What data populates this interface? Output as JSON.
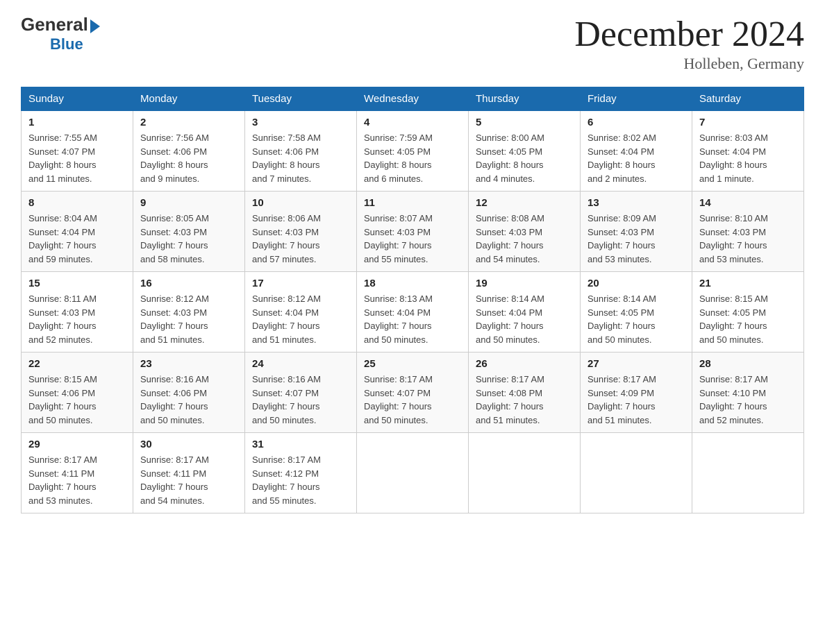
{
  "header": {
    "logo_general": "General",
    "logo_blue": "Blue",
    "calendar_title": "December 2024",
    "location": "Holleben, Germany"
  },
  "days_of_week": [
    "Sunday",
    "Monday",
    "Tuesday",
    "Wednesday",
    "Thursday",
    "Friday",
    "Saturday"
  ],
  "weeks": [
    [
      {
        "num": "1",
        "sunrise": "7:55 AM",
        "sunset": "4:07 PM",
        "daylight": "8 hours and 11 minutes."
      },
      {
        "num": "2",
        "sunrise": "7:56 AM",
        "sunset": "4:06 PM",
        "daylight": "8 hours and 9 minutes."
      },
      {
        "num": "3",
        "sunrise": "7:58 AM",
        "sunset": "4:06 PM",
        "daylight": "8 hours and 7 minutes."
      },
      {
        "num": "4",
        "sunrise": "7:59 AM",
        "sunset": "4:05 PM",
        "daylight": "8 hours and 6 minutes."
      },
      {
        "num": "5",
        "sunrise": "8:00 AM",
        "sunset": "4:05 PM",
        "daylight": "8 hours and 4 minutes."
      },
      {
        "num": "6",
        "sunrise": "8:02 AM",
        "sunset": "4:04 PM",
        "daylight": "8 hours and 2 minutes."
      },
      {
        "num": "7",
        "sunrise": "8:03 AM",
        "sunset": "4:04 PM",
        "daylight": "8 hours and 1 minute."
      }
    ],
    [
      {
        "num": "8",
        "sunrise": "8:04 AM",
        "sunset": "4:04 PM",
        "daylight": "7 hours and 59 minutes."
      },
      {
        "num": "9",
        "sunrise": "8:05 AM",
        "sunset": "4:03 PM",
        "daylight": "7 hours and 58 minutes."
      },
      {
        "num": "10",
        "sunrise": "8:06 AM",
        "sunset": "4:03 PM",
        "daylight": "7 hours and 57 minutes."
      },
      {
        "num": "11",
        "sunrise": "8:07 AM",
        "sunset": "4:03 PM",
        "daylight": "7 hours and 55 minutes."
      },
      {
        "num": "12",
        "sunrise": "8:08 AM",
        "sunset": "4:03 PM",
        "daylight": "7 hours and 54 minutes."
      },
      {
        "num": "13",
        "sunrise": "8:09 AM",
        "sunset": "4:03 PM",
        "daylight": "7 hours and 53 minutes."
      },
      {
        "num": "14",
        "sunrise": "8:10 AM",
        "sunset": "4:03 PM",
        "daylight": "7 hours and 53 minutes."
      }
    ],
    [
      {
        "num": "15",
        "sunrise": "8:11 AM",
        "sunset": "4:03 PM",
        "daylight": "7 hours and 52 minutes."
      },
      {
        "num": "16",
        "sunrise": "8:12 AM",
        "sunset": "4:03 PM",
        "daylight": "7 hours and 51 minutes."
      },
      {
        "num": "17",
        "sunrise": "8:12 AM",
        "sunset": "4:04 PM",
        "daylight": "7 hours and 51 minutes."
      },
      {
        "num": "18",
        "sunrise": "8:13 AM",
        "sunset": "4:04 PM",
        "daylight": "7 hours and 50 minutes."
      },
      {
        "num": "19",
        "sunrise": "8:14 AM",
        "sunset": "4:04 PM",
        "daylight": "7 hours and 50 minutes."
      },
      {
        "num": "20",
        "sunrise": "8:14 AM",
        "sunset": "4:05 PM",
        "daylight": "7 hours and 50 minutes."
      },
      {
        "num": "21",
        "sunrise": "8:15 AM",
        "sunset": "4:05 PM",
        "daylight": "7 hours and 50 minutes."
      }
    ],
    [
      {
        "num": "22",
        "sunrise": "8:15 AM",
        "sunset": "4:06 PM",
        "daylight": "7 hours and 50 minutes."
      },
      {
        "num": "23",
        "sunrise": "8:16 AM",
        "sunset": "4:06 PM",
        "daylight": "7 hours and 50 minutes."
      },
      {
        "num": "24",
        "sunrise": "8:16 AM",
        "sunset": "4:07 PM",
        "daylight": "7 hours and 50 minutes."
      },
      {
        "num": "25",
        "sunrise": "8:17 AM",
        "sunset": "4:07 PM",
        "daylight": "7 hours and 50 minutes."
      },
      {
        "num": "26",
        "sunrise": "8:17 AM",
        "sunset": "4:08 PM",
        "daylight": "7 hours and 51 minutes."
      },
      {
        "num": "27",
        "sunrise": "8:17 AM",
        "sunset": "4:09 PM",
        "daylight": "7 hours and 51 minutes."
      },
      {
        "num": "28",
        "sunrise": "8:17 AM",
        "sunset": "4:10 PM",
        "daylight": "7 hours and 52 minutes."
      }
    ],
    [
      {
        "num": "29",
        "sunrise": "8:17 AM",
        "sunset": "4:11 PM",
        "daylight": "7 hours and 53 minutes."
      },
      {
        "num": "30",
        "sunrise": "8:17 AM",
        "sunset": "4:11 PM",
        "daylight": "7 hours and 54 minutes."
      },
      {
        "num": "31",
        "sunrise": "8:17 AM",
        "sunset": "4:12 PM",
        "daylight": "7 hours and 55 minutes."
      },
      null,
      null,
      null,
      null
    ]
  ],
  "labels": {
    "sunrise": "Sunrise:",
    "sunset": "Sunset:",
    "daylight": "Daylight:"
  }
}
